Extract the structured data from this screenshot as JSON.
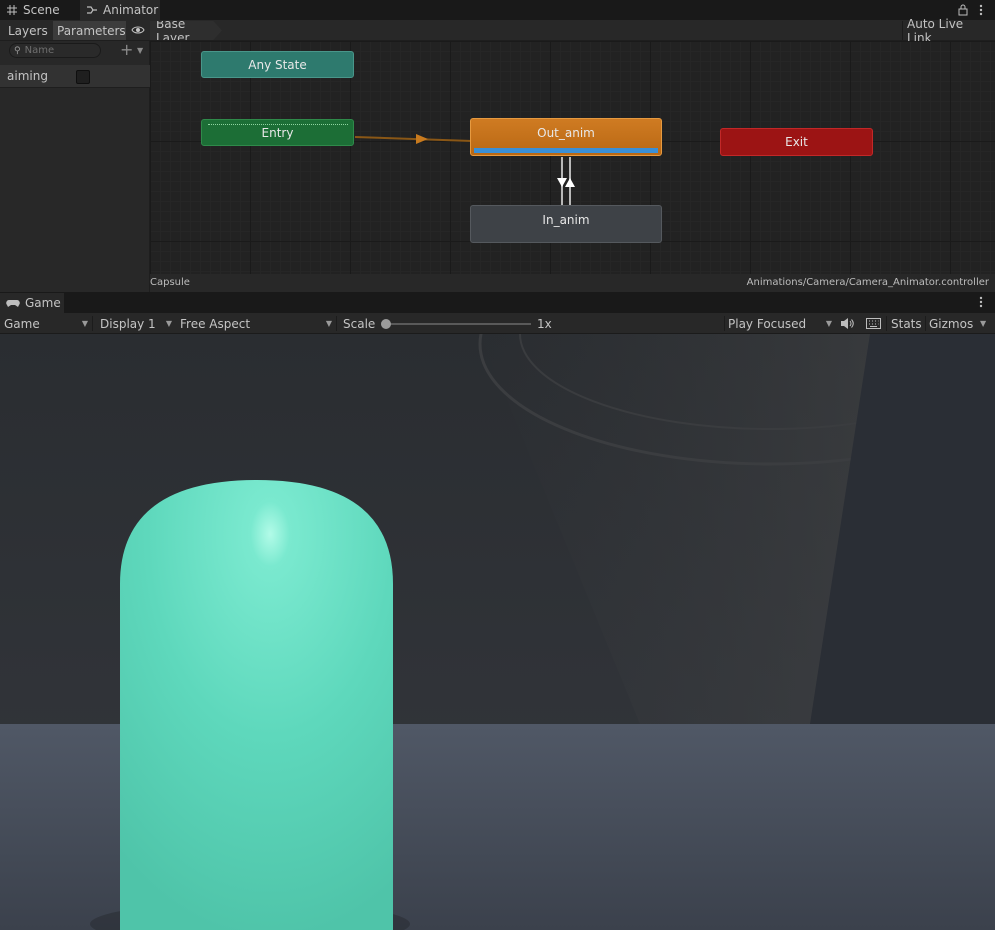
{
  "tabs": {
    "scene": "Scene",
    "animator": "Animator"
  },
  "animator": {
    "toolbar": {
      "layers": "Layers",
      "parameters": "Parameters",
      "breadcrumb": "Base Layer",
      "auto_live_link": "Auto Live Link"
    },
    "search": {
      "placeholder": "Name"
    },
    "parameters": [
      {
        "name": "aiming",
        "type": "bool",
        "value": false
      }
    ],
    "states": {
      "any_state": "Any State",
      "entry": "Entry",
      "out_anim": "Out_anim",
      "exit": "Exit",
      "in_anim": "In_anim"
    },
    "status": {
      "object": "Capsule",
      "controller_path": "Animations/Camera/Camera_Animator.controller"
    },
    "colors": {
      "any_state": "#2e7a6e",
      "entry": "#1c6e36",
      "out_anim": "#c8741e",
      "exit": "#9c1414",
      "in_anim": "#3e4247",
      "progress": "#3a8fd6"
    },
    "out_anim_progress": 1.0
  },
  "game": {
    "tab": "Game",
    "toolbar": {
      "display_mode": "Game",
      "display": "Display 1",
      "aspect": "Free Aspect",
      "scale_label": "Scale",
      "scale_value": "1x",
      "play_mode": "Play Focused",
      "stats": "Stats",
      "gizmos": "Gizmos"
    },
    "capsule_color": "#62dcc0"
  }
}
